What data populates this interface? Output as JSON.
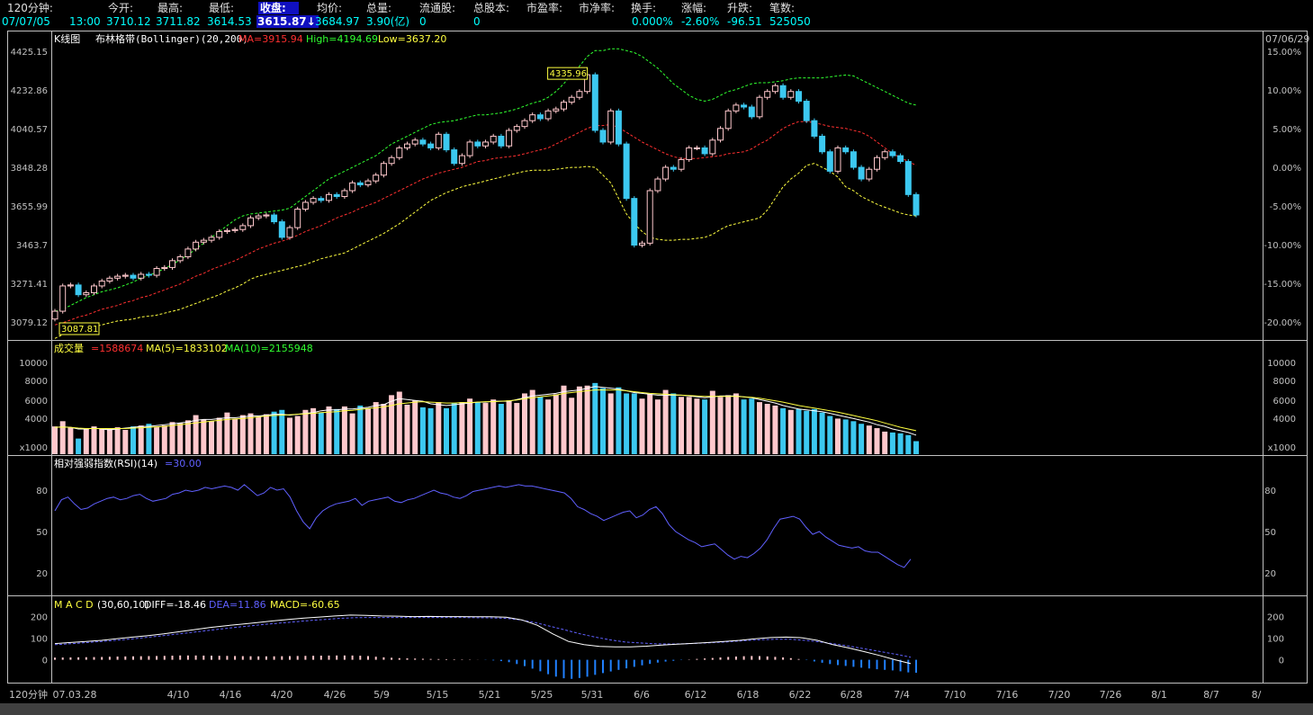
{
  "header": {
    "labels": [
      {
        "key": "period",
        "text": "120分钟:"
      },
      {
        "key": "open",
        "text": "今开:"
      },
      {
        "key": "high",
        "text": "最高:"
      },
      {
        "key": "low",
        "text": "最低:"
      },
      {
        "key": "close",
        "text": "收盘:"
      },
      {
        "key": "avg",
        "text": "均价:"
      },
      {
        "key": "vol",
        "text": "总量:"
      },
      {
        "key": "float",
        "text": "流通股:"
      },
      {
        "key": "total",
        "text": "总股本:"
      },
      {
        "key": "pe",
        "text": "市盈率:"
      },
      {
        "key": "pb",
        "text": "市净率:"
      },
      {
        "key": "turnover",
        "text": "换手:"
      },
      {
        "key": "chg_pct",
        "text": "涨幅:"
      },
      {
        "key": "chg",
        "text": "升跌:"
      },
      {
        "key": "trades",
        "text": "笔数:"
      }
    ],
    "values": {
      "date": "07/07/05",
      "time": "13:00",
      "open": "3710.12",
      "high": "3711.82",
      "low": "3614.53",
      "close": "3615.87",
      "close_arrow": "↓",
      "avg": "3684.97",
      "vol": "3.90(亿)",
      "float": "0",
      "total": "0",
      "turnover": "0.000%",
      "chg_pct": "-2.60%",
      "chg": "-96.51",
      "trades": "525050"
    }
  },
  "kline_panel": {
    "title": "K线图",
    "indicator": "布林格带(Bollinger)(20,200)",
    "ma": "MA=3915.94",
    "high": "High=4194.69",
    "low": "Low=3637.20",
    "top_right_date": "07/06/29",
    "max_label": "4335.96",
    "min_label": "3087.81"
  },
  "volume_panel": {
    "title": "成交量",
    "v": "=1588674",
    "ma5": "MA(5)=1833102",
    "ma10": "MA(10)=2155948",
    "unit": "x1000"
  },
  "rsi_panel": {
    "title": "相对强弱指数(RSI)(14)",
    "v": "=30.00"
  },
  "macd_panel": {
    "title": "M A C D",
    "params": "(30,60,10)",
    "diff": "DIFF=-18.46",
    "dea": "DEA=11.86",
    "macd": "MACD=-60.65"
  },
  "footer": {
    "period_label": "120分钟"
  },
  "colors": {
    "up": "#ffc8cc",
    "down": "#3cc8f0",
    "ma": "#ff3030",
    "band": "#ffff40",
    "upperband": "#30ff30",
    "rsi": "#6060ff",
    "diff": "#ffffff",
    "dea": "#6060ff",
    "grid": "#c0c0c0"
  },
  "chart_data": [
    {
      "type": "candlestick",
      "title": "K线图 布林格带(Bollinger)(20,200)",
      "ylabel": "",
      "y_ticks": [
        "4425.15",
        "4232.86",
        "4040.57",
        "3848.28",
        "3655.99",
        "3463.7",
        "3271.41",
        "3079.12"
      ],
      "right_ticks": [
        "15.00%",
        "10.00%",
        "5.00%",
        "0.00%",
        "-5.00%",
        "-10.00%",
        "-15.00%",
        "-20.00%"
      ],
      "ylim": [
        3000,
        4480
      ],
      "x_ticks": [
        "07.03.28",
        "4/10",
        "4/16",
        "4/20",
        "4/26",
        "5/9",
        "5/15",
        "5/21",
        "5/25",
        "5/31",
        "6/6",
        "6/12",
        "6/18",
        "6/22",
        "6/28",
        "7/4",
        "7/10",
        "7/16",
        "7/20",
        "7/26",
        "8/1",
        "8/7",
        "8/"
      ],
      "close": [
        3120,
        3250,
        3255,
        3205,
        3215,
        3250,
        3275,
        3290,
        3300,
        3305,
        3290,
        3310,
        3305,
        3340,
        3345,
        3380,
        3400,
        3440,
        3475,
        3485,
        3500,
        3530,
        3535,
        3540,
        3560,
        3600,
        3610,
        3615,
        3580,
        3500,
        3550,
        3645,
        3680,
        3700,
        3690,
        3720,
        3710,
        3740,
        3780,
        3770,
        3790,
        3820,
        3880,
        3910,
        3960,
        3980,
        4000,
        3980,
        3960,
        4030,
        3950,
        3880,
        3920,
        3990,
        3970,
        3990,
        4020,
        3970,
        4050,
        4070,
        4100,
        4130,
        4110,
        4150,
        4160,
        4195,
        4220,
        4250,
        4336,
        4050,
        3990,
        4150,
        3980,
        3700,
        3460,
        3470,
        3740,
        3800,
        3860,
        3850,
        3900,
        3960,
        3960,
        3930,
        4000,
        4060,
        4150,
        4180,
        4170,
        4120,
        4220,
        4250,
        4280,
        4220,
        4250,
        4200,
        4100,
        4020,
        3940,
        3840,
        3960,
        3940,
        3860,
        3800,
        3850,
        3910,
        3940,
        3920,
        3890,
        3720,
        3615
      ],
      "ma": [
        3050,
        3060,
        3075,
        3090,
        3100,
        3115,
        3130,
        3140,
        3150,
        3165,
        3175,
        3190,
        3200,
        3215,
        3230,
        3245,
        3260,
        3280,
        3300,
        3315,
        3335,
        3350,
        3365,
        3380,
        3400,
        3420,
        3440,
        3455,
        3470,
        3480,
        3495,
        3510,
        3530,
        3545,
        3560,
        3580,
        3600,
        3615,
        3630,
        3650,
        3665,
        3680,
        3700,
        3720,
        3740,
        3760,
        3780,
        3800,
        3815,
        3830,
        3840,
        3850,
        3860,
        3875,
        3890,
        3895,
        3905,
        3910,
        3915,
        3920,
        3930,
        3940,
        3950,
        3960,
        3980,
        4000,
        4020,
        4040,
        4060,
        4075,
        4075,
        4080,
        4065,
        4040,
        4015,
        3990,
        3970,
        3950,
        3930,
        3915,
        3905,
        3905,
        3905,
        3910,
        3915,
        3920,
        3930,
        3935,
        3940,
        3955,
        3980,
        4000,
        4030,
        4060,
        4080,
        4095,
        4095,
        4090,
        4080,
        4070,
        4065,
        4060,
        4050,
        4040,
        4020,
        3990,
        3960,
        3930,
        3910,
        3890,
        3870
      ],
      "upper": [
        3120,
        3130,
        3150,
        3170,
        3190,
        3205,
        3220,
        3230,
        3240,
        3255,
        3270,
        3290,
        3305,
        3320,
        3340,
        3360,
        3385,
        3410,
        3440,
        3470,
        3500,
        3530,
        3560,
        3590,
        3610,
        3620,
        3625,
        3630,
        3635,
        3640,
        3650,
        3680,
        3710,
        3740,
        3770,
        3800,
        3820,
        3840,
        3860,
        3880,
        3900,
        3920,
        3950,
        3980,
        4000,
        4020,
        4040,
        4060,
        4080,
        4090,
        4095,
        4100,
        4110,
        4120,
        4130,
        4130,
        4135,
        4140,
        4150,
        4160,
        4175,
        4190,
        4200,
        4220,
        4250,
        4290,
        4340,
        4380,
        4430,
        4460,
        4460,
        4470,
        4470,
        4460,
        4450,
        4430,
        4400,
        4370,
        4330,
        4290,
        4260,
        4230,
        4210,
        4200,
        4210,
        4230,
        4250,
        4260,
        4275,
        4290,
        4295,
        4295,
        4300,
        4305,
        4315,
        4320,
        4320,
        4320,
        4320,
        4325,
        4330,
        4335,
        4330,
        4310,
        4290,
        4270,
        4250,
        4230,
        4210,
        4190,
        4180
      ],
      "lower": [
        2980,
        3000,
        3010,
        3020,
        3030,
        3040,
        3050,
        3060,
        3070,
        3075,
        3080,
        3090,
        3095,
        3100,
        3110,
        3120,
        3130,
        3145,
        3160,
        3175,
        3190,
        3205,
        3225,
        3240,
        3260,
        3285,
        3300,
        3310,
        3320,
        3330,
        3340,
        3350,
        3360,
        3375,
        3390,
        3400,
        3410,
        3420,
        3440,
        3460,
        3480,
        3500,
        3520,
        3545,
        3570,
        3600,
        3630,
        3660,
        3690,
        3710,
        3730,
        3745,
        3760,
        3770,
        3780,
        3790,
        3800,
        3810,
        3820,
        3830,
        3840,
        3845,
        3845,
        3845,
        3850,
        3855,
        3860,
        3860,
        3865,
        3860,
        3820,
        3780,
        3700,
        3620,
        3570,
        3530,
        3500,
        3490,
        3485,
        3485,
        3490,
        3490,
        3495,
        3500,
        3515,
        3540,
        3560,
        3570,
        3580,
        3590,
        3600,
        3640,
        3700,
        3760,
        3800,
        3830,
        3870,
        3880,
        3860,
        3840,
        3810,
        3760,
        3740,
        3710,
        3690,
        3670,
        3655,
        3640,
        3625,
        3615,
        3610
      ],
      "series": [
        {
          "name": "MA",
          "values": "ma"
        },
        {
          "name": "High",
          "values": "upper"
        },
        {
          "name": "Low",
          "values": "lower"
        }
      ]
    },
    {
      "type": "bar",
      "title": "成交量",
      "y_ticks": [
        "10000",
        "8000",
        "6000",
        "4000",
        "x1000"
      ],
      "ylim": [
        0,
        11500
      ],
      "values": [
        3200,
        3800,
        3100,
        1800,
        3000,
        3200,
        3000,
        2900,
        3100,
        2800,
        3200,
        3300,
        3500,
        3100,
        3300,
        3700,
        3600,
        3900,
        4500,
        4000,
        3800,
        4200,
        4800,
        4100,
        4500,
        4700,
        4300,
        4600,
        4900,
        5100,
        4200,
        4400,
        5100,
        5300,
        4800,
        5500,
        5200,
        5500,
        4700,
        5600,
        5300,
        6000,
        5800,
        6800,
        7200,
        5700,
        6200,
        5400,
        5300,
        6000,
        5300,
        5900,
        6000,
        6400,
        6000,
        5900,
        6300,
        5800,
        6200,
        5900,
        7000,
        7400,
        6600,
        6300,
        6900,
        7900,
        6500,
        7800,
        7900,
        8200,
        7600,
        7000,
        7700,
        7000,
        7000,
        6400,
        6900,
        6300,
        7400,
        7000,
        6600,
        6600,
        6400,
        6300,
        7300,
        6600,
        6800,
        7000,
        6300,
        6400,
        6000,
        5800,
        5600,
        5300,
        5100,
        5200,
        5000,
        5200,
        4800,
        4400,
        4100,
        4000,
        3800,
        3500,
        3300,
        3000,
        2600,
        2500,
        2400,
        2200,
        1500
      ],
      "ma5": [
        3100,
        3150,
        3100,
        2900,
        2900,
        3000,
        2900,
        2800,
        2900,
        3000,
        3100,
        3200,
        3200,
        3300,
        3400,
        3500,
        3600,
        3700,
        3900,
        4000,
        4000,
        4100,
        4200,
        4200,
        4300,
        4400,
        4400,
        4500,
        4600,
        4600,
        4500,
        4600,
        4700,
        4800,
        5000,
        5100,
        5100,
        5200,
        5200,
        5300,
        5400,
        5600,
        5700,
        6100,
        6400,
        6300,
        6200,
        6100,
        5800,
        5700,
        5600,
        5700,
        5800,
        5900,
        6000,
        6000,
        6100,
        6100,
        6100,
        6300,
        6500,
        6700,
        6800,
        6900,
        7000,
        7200,
        7300,
        7400,
        7600,
        7800,
        7700,
        7600,
        7500,
        7300,
        7100,
        7000,
        6900,
        6800,
        6800,
        6800,
        6800,
        6700,
        6600,
        6500,
        6600,
        6700,
        6700,
        6700,
        6600,
        6500,
        6300,
        6100,
        5900,
        5600,
        5400,
        5200,
        5100,
        5000,
        4900,
        4700,
        4500,
        4300,
        4100,
        3900,
        3700,
        3400,
        3200,
        2900,
        2700,
        2500,
        2200
      ],
      "ma10": [
        3100,
        3120,
        3100,
        3000,
        2950,
        2950,
        2950,
        2950,
        2950,
        2950,
        3000,
        3050,
        3100,
        3150,
        3200,
        3300,
        3400,
        3500,
        3600,
        3700,
        3800,
        3900,
        4000,
        4050,
        4100,
        4200,
        4300,
        4400,
        4450,
        4500,
        4550,
        4600,
        4650,
        4700,
        4800,
        4850,
        4900,
        5000,
        5050,
        5150,
        5250,
        5350,
        5450,
        5600,
        5800,
        5900,
        6000,
        6050,
        6000,
        5950,
        5900,
        5900,
        5950,
        5950,
        6000,
        6050,
        6050,
        6100,
        6150,
        6250,
        6400,
        6500,
        6600,
        6700,
        6800,
        7000,
        7100,
        7200,
        7300,
        7400,
        7400,
        7400,
        7400,
        7300,
        7200,
        7100,
        7000,
        6950,
        6900,
        6850,
        6800,
        6750,
        6700,
        6650,
        6650,
        6650,
        6650,
        6650,
        6600,
        6550,
        6450,
        6300,
        6150,
        6000,
        5800,
        5600,
        5450,
        5300,
        5150,
        5000,
        4850,
        4650,
        4450,
        4250,
        4050,
        3850,
        3600,
        3350,
        3100,
        2900,
        2700
      ],
      "series": [
        {
          "name": "MA(5)",
          "values": "ma5"
        },
        {
          "name": "MA(10)",
          "values": "ma10"
        }
      ]
    },
    {
      "type": "line",
      "title": "相对强弱指数(RSI)(14)",
      "y_ticks": [
        "80",
        "50",
        "20"
      ],
      "ylim": [
        5,
        95
      ],
      "values": [
        65,
        73,
        75,
        70,
        66,
        67,
        70,
        72,
        74,
        75,
        73,
        74,
        76,
        77,
        74,
        72,
        73,
        74,
        77,
        78,
        80,
        79,
        80,
        82,
        81,
        82,
        83,
        82,
        80,
        84,
        80,
        76,
        78,
        82,
        80,
        81,
        75,
        65,
        57,
        52,
        60,
        65,
        68,
        70,
        71,
        72,
        74,
        69,
        72,
        73,
        74,
        75,
        72,
        71,
        73,
        74,
        76,
        78,
        80,
        78,
        77,
        75,
        74,
        76,
        79,
        80,
        81,
        82,
        83,
        82,
        83,
        84,
        83,
        83,
        82,
        81,
        80,
        79,
        78,
        74,
        68,
        66,
        63,
        61,
        58,
        60,
        62,
        64,
        65,
        60,
        62,
        66,
        68,
        63,
        55,
        50,
        47,
        44,
        42,
        39,
        40,
        41,
        37,
        33,
        30,
        32,
        31,
        34,
        38,
        44,
        52,
        59,
        60,
        61,
        59,
        53,
        48,
        50,
        46,
        43,
        40,
        39,
        38,
        39,
        36,
        35,
        35,
        32,
        29,
        26,
        24,
        30
      ],
      "note": "visible RSI line sampled across the trace",
      "series": [
        {
          "name": "RSI",
          "values": "values"
        }
      ]
    },
    {
      "type": "line",
      "title": "M A C D (30,60,10)",
      "y_ticks": [
        "200",
        "100",
        "0"
      ],
      "ylim": [
        -110,
        240
      ],
      "diff": [
        75,
        80,
        85,
        90,
        98,
        105,
        112,
        120,
        130,
        140,
        150,
        158,
        165,
        172,
        180,
        187,
        193,
        198,
        203,
        207,
        206,
        203,
        202,
        200,
        201,
        200,
        200,
        199,
        199,
        197,
        185,
        160,
        120,
        85,
        70,
        62,
        60,
        60,
        63,
        68,
        72,
        76,
        80,
        85,
        90,
        97,
        103,
        105,
        102,
        90,
        70,
        55,
        38,
        20,
        0,
        -18
      ],
      "dea": [
        70,
        74,
        79,
        84,
        90,
        96,
        103,
        110,
        118,
        126,
        134,
        142,
        150,
        157,
        164,
        170,
        176,
        182,
        187,
        192,
        195,
        196,
        196,
        196,
        196,
        196,
        196,
        196,
        195,
        194,
        192,
        185,
        172,
        155,
        138,
        120,
        105,
        92,
        82,
        78,
        74,
        73,
        74,
        77,
        80,
        84,
        89,
        93,
        95,
        95,
        90,
        82,
        73,
        62,
        50,
        38,
        26,
        12
      ],
      "macd": [
        10,
        11,
        12,
        13,
        15,
        16,
        17,
        18,
        20,
        20,
        19,
        18,
        17,
        16,
        16,
        17,
        18,
        19,
        20,
        20,
        18,
        12,
        8,
        6,
        4,
        3,
        2,
        1,
        -2,
        -8,
        -25,
        -48,
        -75,
        -90,
        -82,
        -65,
        -50,
        -36,
        -22,
        -10,
        -3,
        3,
        7,
        12,
        16,
        18,
        15,
        10,
        2,
        -10,
        -22,
        -30,
        -38,
        -45,
        -50,
        -60
      ],
      "series": [
        {
          "name": "DIFF",
          "values": "diff"
        },
        {
          "name": "DEA",
          "values": "dea"
        },
        {
          "name": "MACD",
          "values": "macd"
        }
      ]
    }
  ]
}
